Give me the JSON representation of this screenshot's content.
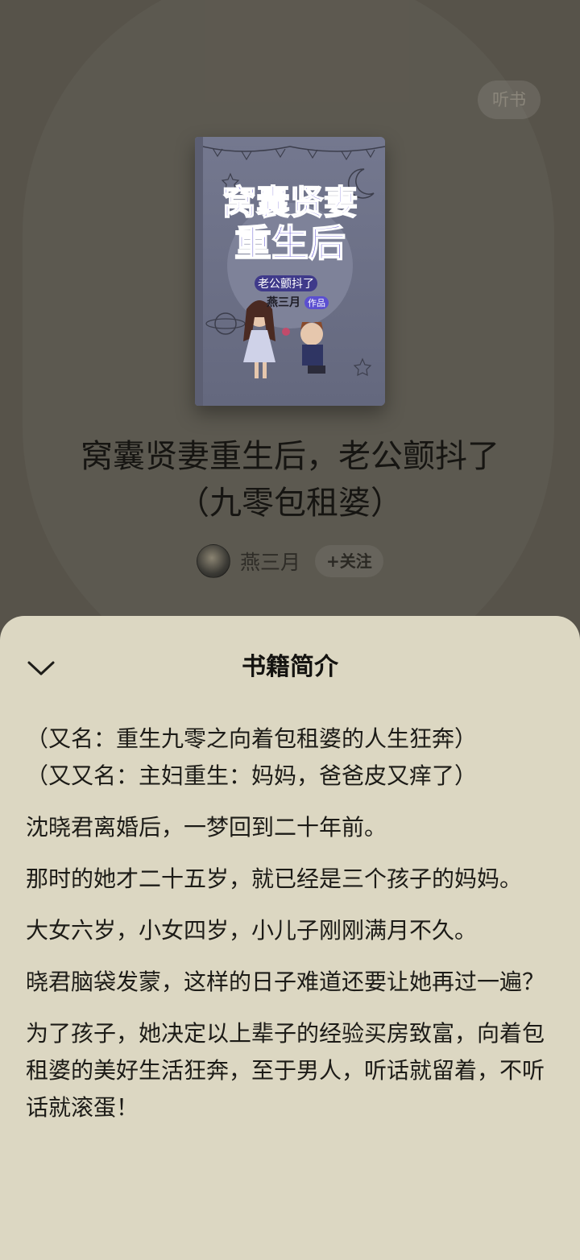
{
  "header": {
    "listen_label": "听书"
  },
  "cover": {
    "title_line1": "窝囊贤妻",
    "title_line2": "重生后",
    "subtitle": "老公颤抖了",
    "author_tag": "燕三月",
    "work_tag": "作品"
  },
  "book": {
    "title_line1": "窝囊贤妻重生后，老公颤抖了",
    "title_line2": "（九零包租婆）"
  },
  "author": {
    "name": "燕三月",
    "follow_label": "+关注"
  },
  "sheet": {
    "title": "书籍简介",
    "paragraphs": [
      "（又名：重生九零之向着包租婆的人生狂奔）",
      "（又又名：主妇重生：妈妈，爸爸皮又痒了）",
      "沈晓君离婚后，一梦回到二十年前。",
      "那时的她才二十五岁，就已经是三个孩子的妈妈。",
      "大女六岁，小女四岁，小儿子刚刚满月不久。",
      "晓君脑袋发蒙，这样的日子难道还要让她再过一遍？",
      "为了孩子，她决定以上辈子的经验买房致富，向着包租婆的美好生活狂奔，至于男人，听话就留着，不听话就滚蛋！"
    ]
  },
  "colors": {
    "overlay_bg": "#57534a",
    "sheet_bg": "#dcd7c2",
    "text_primary": "#1c1b17",
    "cover_title": "#5b4fd0"
  }
}
